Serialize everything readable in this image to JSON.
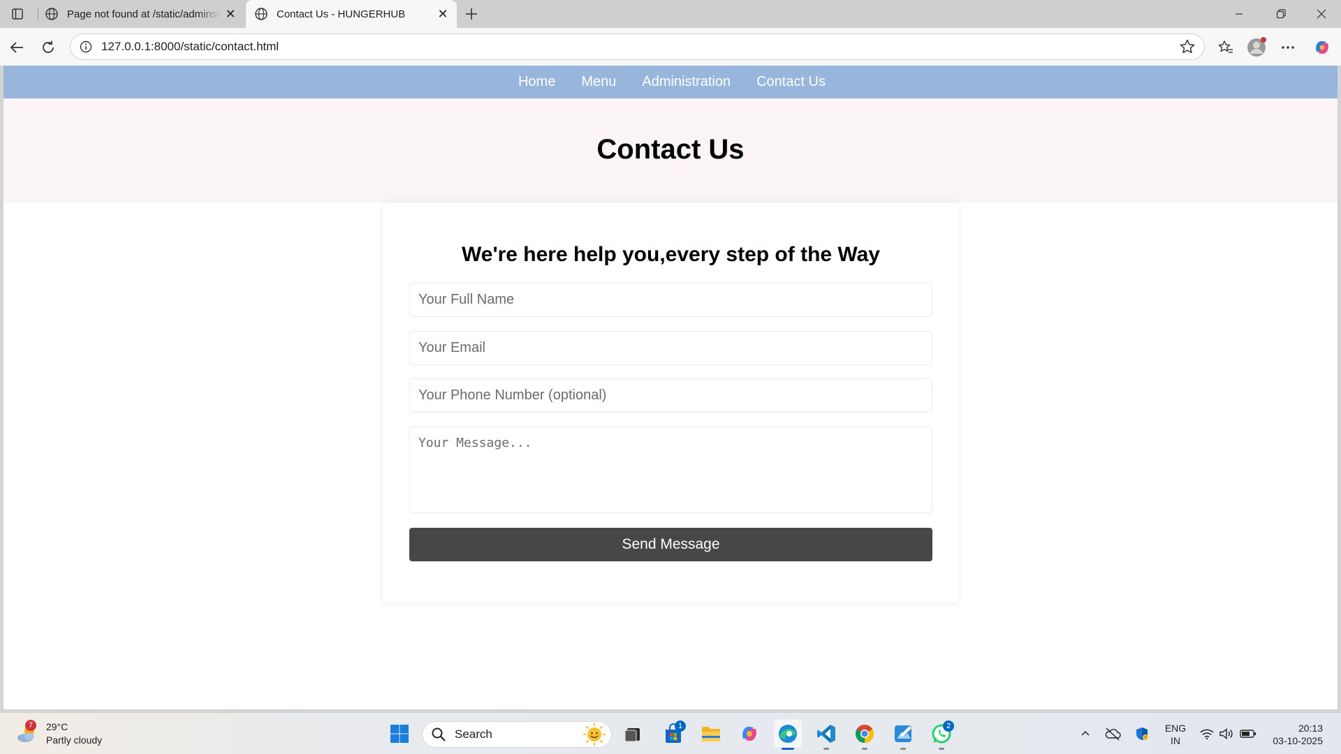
{
  "browser": {
    "tabs": [
      {
        "title": "Page not found at /static/adminstration.html",
        "active": false
      },
      {
        "title": "Contact Us - HUNGERHUB",
        "active": true
      }
    ],
    "url": "127.0.0.1:8000/static/contact.html"
  },
  "page": {
    "nav": [
      "Home",
      "Menu",
      "Administration",
      "Contact Us"
    ],
    "hero_title": "Contact Us",
    "form": {
      "heading": "We're here help you,every step of the Way",
      "name_placeholder": "Your Full Name",
      "email_placeholder": "Your Email",
      "phone_placeholder": "Your Phone Number (optional)",
      "message_placeholder": "Your Message...",
      "submit_label": "Send Message"
    },
    "colors": {
      "nav": "#98b6dc",
      "hero": "#faf3f7",
      "button": "#474747"
    }
  },
  "taskbar": {
    "weather": {
      "temp": "29°C",
      "condition": "Partly cloudy",
      "badge": "7"
    },
    "search_label": "Search",
    "apps": [
      {
        "name": "windows-start-icon"
      },
      {
        "name": "task-view-icon"
      },
      {
        "name": "microsoft-store-icon",
        "badge": "1"
      },
      {
        "name": "file-explorer-icon"
      },
      {
        "name": "copilot-icon"
      },
      {
        "name": "edge-icon",
        "active": true
      },
      {
        "name": "vscode-icon"
      },
      {
        "name": "chrome-icon"
      },
      {
        "name": "paint-icon"
      },
      {
        "name": "whatsapp-icon",
        "badge": "2"
      }
    ],
    "lang": {
      "line1": "ENG",
      "line2": "IN"
    },
    "time": "20:13",
    "date": "03-10-2025"
  }
}
